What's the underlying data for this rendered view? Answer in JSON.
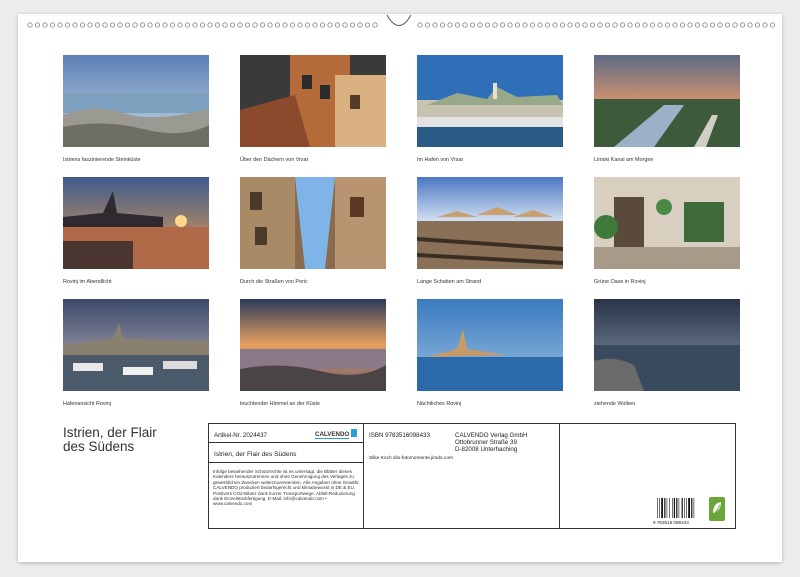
{
  "photos": [
    {
      "caption": "Istriens faszinierende Steinküste",
      "scene": "rocky-coast"
    },
    {
      "caption": "Über den Dächern von Vrsar",
      "scene": "rooftops"
    },
    {
      "caption": "Im Hafen von Vrsar",
      "scene": "harbor-town"
    },
    {
      "caption": "Limski Kanal am Morgen",
      "scene": "fjord"
    },
    {
      "caption": "Rovinj im Abendlicht",
      "scene": "evening-town"
    },
    {
      "caption": "Durch die Straßen von Poric",
      "scene": "street"
    },
    {
      "caption": "Lange Schatten am Strand",
      "scene": "beach"
    },
    {
      "caption": "Grüne Oase in Rovinj",
      "scene": "courtyard"
    },
    {
      "caption": "Hafenansicht Rovinj",
      "scene": "harbor-boats"
    },
    {
      "caption": "leuchtender Himmel an der Küste",
      "scene": "glowing-coast"
    },
    {
      "caption": "Nächtliches Rovinj",
      "scene": "night-town"
    },
    {
      "caption": "ziehende Wolken",
      "scene": "clouds"
    }
  ],
  "title": {
    "line1": "Istrien, der Flair",
    "line2": "des Südens"
  },
  "info": {
    "article_no": "Artikel-Nr. 2024437",
    "logo_text": "CALVENDO",
    "subtitle": "Istrien, der Flair des Südens",
    "legal": "Infolge bestehender Schutzrechte ist es untersagt, die Blätter dieses Kalenders herauszutrennen und ohne Genehmigung des Verlages zu gewerblichen Zwecken weiterzuverwenden. Alle Angaben ohne Gewähr. CALVENDO produziert bedarfsgerecht und klimabewusst in DE & EU. Postivers CO2-Bilanz dank kurzer Transportwege. Abfall-Reduzierung dank Einzelstückfertigung. E-Mail: info@calvendo.com • www.calvendo.com",
    "isbn": "ISBN 9783516098433",
    "publisher_name": "CALVENDO Verlag GmbH",
    "publisher_street": "Ottobrunner Straße 39",
    "publisher_city": "D-82008 Unterhaching",
    "author": "Silke Koch silo-fotomomente.jimdo.com",
    "barcode_number": "9 783516 098433"
  },
  "colors": {
    "paper": "#ffffff",
    "background": "#ededed",
    "eco_badge": "#6aa63a",
    "logo_accent": "#2aa0d8"
  }
}
